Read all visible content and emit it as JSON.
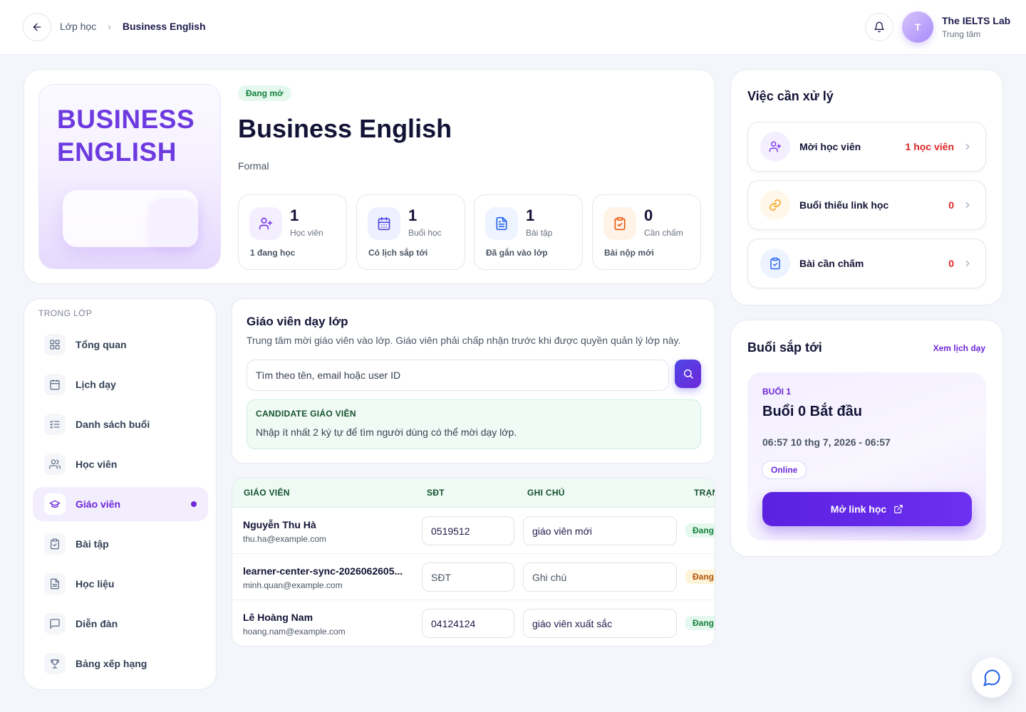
{
  "header": {
    "breadcrumb": [
      "Lớp học",
      "Business English"
    ],
    "org_initial": "T",
    "org_name": "The IELTS Lab",
    "org_role": "Trung tâm"
  },
  "class": {
    "cover_title": "BUSINESS ENGLISH",
    "status": "Đang mở",
    "title": "Business English",
    "subtitle": "Formal",
    "stats": [
      {
        "value": "1",
        "label": "Học viên",
        "foot": "1 đang học",
        "icon": "user-plus-icon",
        "color": "#7c3aed"
      },
      {
        "value": "1",
        "label": "Buổi học",
        "foot": "Có lịch sắp tới",
        "icon": "calendar-icon",
        "color": "#4f46e5"
      },
      {
        "value": "1",
        "label": "Bài tập",
        "foot": "Đã gắn vào lớp",
        "icon": "document-icon",
        "color": "#2563eb"
      },
      {
        "value": "0",
        "label": "Cần chấm",
        "foot": "Bài nộp mới",
        "icon": "clipboard-check-icon",
        "color": "#ea580c"
      }
    ]
  },
  "sidebar": {
    "heading": "TRONG LỚP",
    "items": [
      {
        "label": "Tổng quan",
        "icon": "grid-icon"
      },
      {
        "label": "Lịch dạy",
        "icon": "calendar-icon"
      },
      {
        "label": "Danh sách buổi",
        "icon": "list-check-icon"
      },
      {
        "label": "Học viên",
        "icon": "users-icon"
      },
      {
        "label": "Giáo viên",
        "icon": "graduation-cap-icon",
        "active": true
      },
      {
        "label": "Bài tập",
        "icon": "clipboard-icon"
      },
      {
        "label": "Học liệu",
        "icon": "file-text-icon"
      },
      {
        "label": "Diễn đàn",
        "icon": "message-square-icon"
      },
      {
        "label": "Bảng xếp hạng",
        "icon": "trophy-icon"
      }
    ]
  },
  "teachers": {
    "title": "Giáo viên dạy lớp",
    "desc": "Trung tâm mời giáo viên vào lớp. Giáo viên phải chấp nhận trước khi được quyền quản lý lớp này.",
    "search_placeholder": "Tìm theo tên, email hoặc user ID",
    "candidate_title": "CANDIDATE GIÁO VIÊN",
    "candidate_hint": "Nhập ít nhất 2 ký tự để tìm người dùng có thể mời dạy lớp.",
    "columns": [
      "GIÁO VIÊN",
      "SĐT",
      "GHI CHÚ",
      "TRẠNG"
    ],
    "rows": [
      {
        "name": "Nguyễn Thu Hà",
        "email": "thu.ha@example.com",
        "phone": "0519512",
        "phone_placeholder": "SĐT",
        "note": "giáo viên mới",
        "note_placeholder": "Ghi chú",
        "status": "Đang",
        "status_color": "#15803d",
        "status_bg": "#e5f8ee"
      },
      {
        "name": "learner-center-sync-2026062605...",
        "email": "minh.quan@example.com",
        "phone": "",
        "phone_placeholder": "SĐT",
        "note": "",
        "note_placeholder": "Ghi chú",
        "status": "Đang",
        "status_color": "#b45309",
        "status_bg": "#fdf3d6"
      },
      {
        "name": "Lê Hoàng Nam",
        "email": "hoang.nam@example.com",
        "phone": "04124124",
        "phone_placeholder": "SĐT",
        "note": "giáo viên xuất sắc",
        "note_placeholder": "Ghi chú",
        "status": "Đang",
        "status_color": "#15803d",
        "status_bg": "#e5f8ee"
      }
    ]
  },
  "todo": {
    "title": "Việc cần xử lý",
    "items": [
      {
        "label": "Mời học viên",
        "value": "1 học viên",
        "icon": "user-plus-icon",
        "icon_color": "#7c3aed",
        "icon_bg": "#f3efff"
      },
      {
        "label": "Buổi thiếu link học",
        "value": "0",
        "icon": "link-icon",
        "icon_color": "#f59e0b",
        "icon_bg": "#fff7ea"
      },
      {
        "label": "Bài cần chấm",
        "value": "0",
        "icon": "clipboard-check-icon",
        "icon_color": "#2563eb",
        "icon_bg": "#edf3ff"
      }
    ]
  },
  "upcoming": {
    "title": "Buổi sắp tới",
    "link": "Xem lịch dạy",
    "session_label": "BUỔI 1",
    "session_name": "Buổi 0 Bắt đầu",
    "time": "06:57 10 thg 7, 2026 - 06:57",
    "mode": "Online",
    "button": "Mở link học"
  }
}
